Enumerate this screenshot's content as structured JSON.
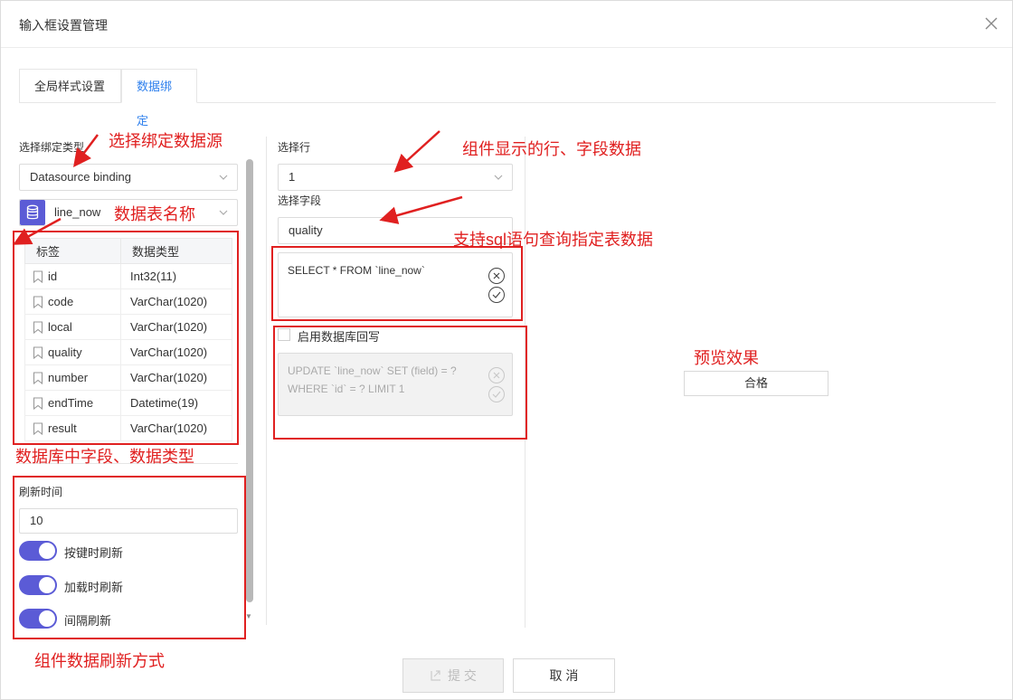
{
  "dialog": {
    "title": "输入框设置管理"
  },
  "tabs": [
    {
      "label": "全局样式设置"
    },
    {
      "label": "数据绑定"
    }
  ],
  "left": {
    "binding_type_label": "选择绑定类型",
    "binding_type_value": "Datasource binding",
    "table_name": "line_now",
    "table": {
      "headers": [
        "标签",
        "数据类型"
      ],
      "rows": [
        {
          "name": "id",
          "type": "Int32(11)"
        },
        {
          "name": "code",
          "type": "VarChar(1020)"
        },
        {
          "name": "local",
          "type": "VarChar(1020)"
        },
        {
          "name": "quality",
          "type": "VarChar(1020)"
        },
        {
          "name": "number",
          "type": "VarChar(1020)"
        },
        {
          "name": "endTime",
          "type": "Datetime(19)"
        },
        {
          "name": "result",
          "type": "VarChar(1020)"
        }
      ]
    },
    "refresh_label": "刷新时间",
    "refresh_value": "10",
    "toggles": [
      {
        "label": "按键时刷新",
        "on": true
      },
      {
        "label": "加载时刷新",
        "on": true
      },
      {
        "label": "间隔刷新",
        "on": true
      }
    ]
  },
  "middle": {
    "row_label": "选择行",
    "row_value": "1",
    "field_label": "选择字段",
    "field_value": "quality",
    "sql_query": "SELECT * FROM `line_now`",
    "writeback_label": "启用数据库回写",
    "writeback_checked": false,
    "update_sql_line1": "UPDATE `line_now` SET (field) = ?",
    "update_sql_line2": "WHERE `id` = ? LIMIT 1"
  },
  "preview": {
    "button_label": "合格"
  },
  "footer": {
    "submit_label": "提 交",
    "cancel_label": "取 消"
  },
  "annotations": {
    "datasource": "选择绑定数据源",
    "table_name": "数据表名称",
    "fields_types": "数据库中字段、数据类型",
    "refresh_mode": "组件数据刷新方式",
    "row_field": "组件显示的行、字段数据",
    "sql_support": "支持sql语句查询指定表数据",
    "preview": "预览效果"
  },
  "colors": {
    "accent": "#2f80ed",
    "toggle": "#5b5bd6",
    "annotation": "#e02020"
  },
  "icons": [
    "close-icon",
    "chevron-down-icon",
    "database-icon",
    "bookmark-icon",
    "x-circle-icon",
    "check-circle-icon",
    "submit-icon"
  ]
}
